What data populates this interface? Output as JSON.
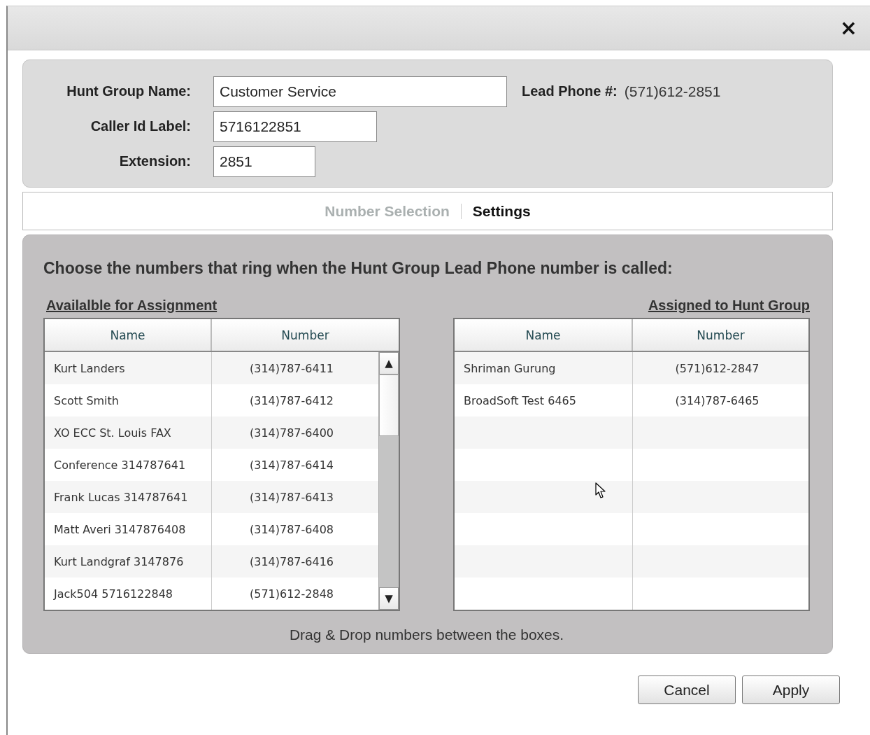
{
  "window": {
    "close": "×"
  },
  "form": {
    "fields": [
      {
        "label": "Hunt Group Name:",
        "value": "Customer Service"
      },
      {
        "label": "Caller Id Label:",
        "value": "5716122851"
      },
      {
        "label": "Extension:",
        "value": "2851"
      }
    ],
    "lead_phone": {
      "label": "Lead Phone #:",
      "value": "(571)612-2851"
    }
  },
  "tabs": [
    {
      "label": "Number Selection",
      "selected": true
    },
    {
      "label": "Settings",
      "selected": false
    }
  ],
  "instructions": "Choose the numbers that ring when the Hunt Group Lead Phone number is called:",
  "available": {
    "title": "Availalble for Assignment",
    "columns": [
      "Name",
      "Number"
    ],
    "rows": [
      {
        "name": "Kurt Landers",
        "number": "(314)787-6411"
      },
      {
        "name": "Scott Smith",
        "number": "(314)787-6412"
      },
      {
        "name": "XO ECC St. Louis FAX",
        "number": "(314)787-6400"
      },
      {
        "name": "Conference 314787641",
        "number": "(314)787-6414"
      },
      {
        "name": "Frank Lucas 314787641",
        "number": "(314)787-6413"
      },
      {
        "name": "Matt Averi 3147876408",
        "number": "(314)787-6408"
      },
      {
        "name": "Kurt Landgraf 3147876",
        "number": "(314)787-6416"
      },
      {
        "name": "Jack504 5716122848",
        "number": "(571)612-2848"
      }
    ],
    "scroll_up": "▲",
    "scroll_down": "▼"
  },
  "assigned": {
    "title": "Assigned to Hunt Group",
    "columns": [
      "Name",
      "Number"
    ],
    "rows": [
      {
        "name": "Shriman Gurung",
        "number": "(571)612-2847"
      },
      {
        "name": "BroadSoft Test 6465",
        "number": "(314)787-6465"
      }
    ]
  },
  "hint": "Drag & Drop numbers between the boxes.",
  "buttons": [
    "Cancel",
    "Apply"
  ]
}
